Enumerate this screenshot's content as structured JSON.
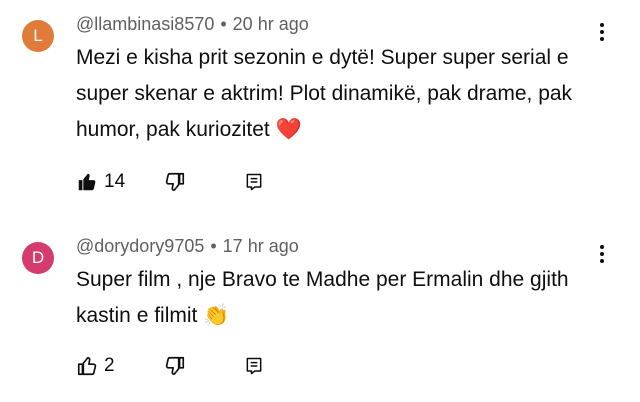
{
  "comments": [
    {
      "avatar_letter": "L",
      "avatar_color": "#e07b39",
      "username": "@llambinasi8570",
      "separator": "•",
      "time": "20 hr ago",
      "text": "Mezi e kisha prit sezonin e dytë! Super super serial e super skenar e aktrim! Plot dinamikë, pak drame, pak humor, pak kuriozitet ❤️",
      "likes": "14",
      "liked": true
    },
    {
      "avatar_letter": "D",
      "avatar_color": "#d63b6e",
      "username": "@dorydory9705",
      "separator": "•",
      "time": "17 hr ago",
      "text": "Super film , nje Bravo te Madhe per Ermalin dhe gjith kastin e filmit 👏",
      "likes": "2",
      "liked": false
    }
  ]
}
